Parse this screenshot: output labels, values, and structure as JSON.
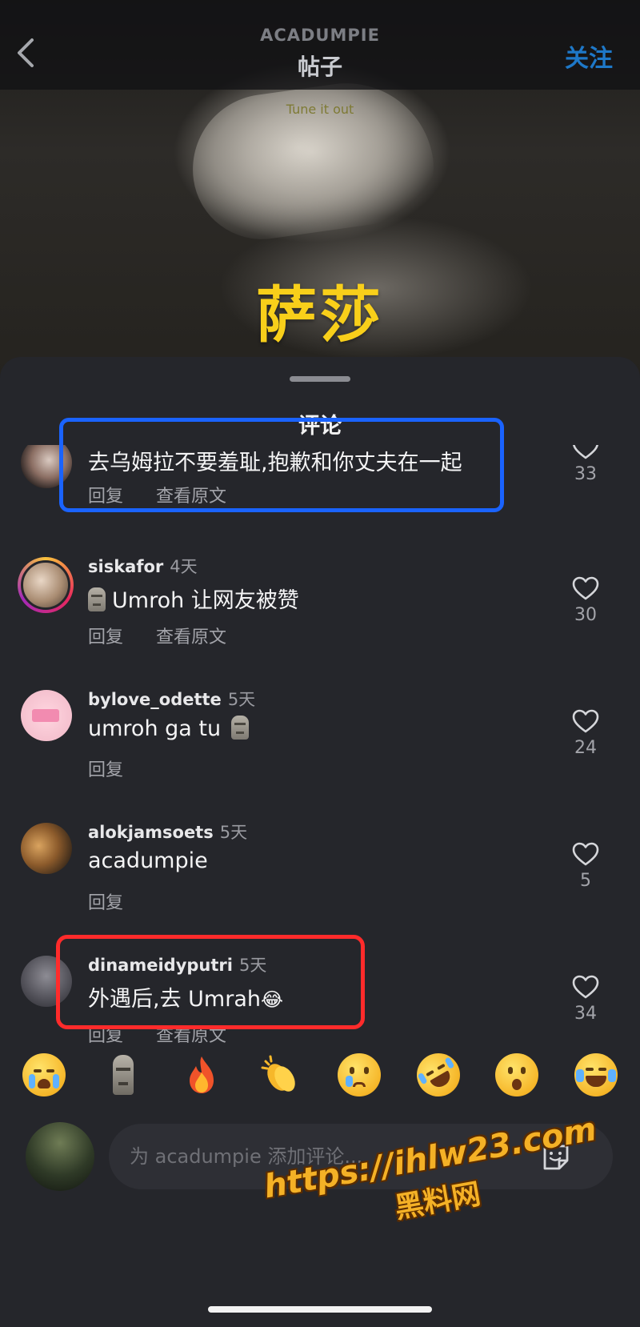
{
  "header": {
    "username": "ACADUMPIE",
    "title": "帖子",
    "follow_label": "关注"
  },
  "video": {
    "music_tag": "Tune it out",
    "caption": "萨莎"
  },
  "comments_sheet": {
    "title": "评论",
    "comments": [
      {
        "username": "",
        "time": "",
        "text": "去乌姆拉不要羞耻,抱歉和你丈夫在一起",
        "reply_label": "回复",
        "see_original_label": "查看原文",
        "likes": "33"
      },
      {
        "username": "siskafor",
        "time": "4天",
        "text": "Umroh 让网友被赞",
        "reply_label": "回复",
        "see_original_label": "查看原文",
        "likes": "30"
      },
      {
        "username": "bylove_odette",
        "time": "5天",
        "text": "umroh ga tu",
        "reply_label": "回复",
        "see_original_label": "",
        "likes": "24"
      },
      {
        "username": "alokjamsoets",
        "time": "5天",
        "text": "acadumpie",
        "reply_label": "回复",
        "see_original_label": "",
        "likes": "5"
      },
      {
        "username": "dinameidyputri",
        "time": "5天",
        "text": "外遇后,去 Umrah",
        "reply_label": "回复",
        "see_original_label": "查看原文",
        "likes": "34"
      }
    ]
  },
  "emoji_bar": [
    "loudly-crying-face",
    "moai",
    "fire",
    "clapping-hands",
    "crying-face",
    "rolling-on-floor-laughing",
    "surprised-face",
    "face-with-tears-of-joy"
  ],
  "comment_input": {
    "placeholder": "为 acadumpie 添加评论..."
  },
  "watermark": {
    "url": "https://ihlw23.com",
    "name": "黑料网"
  },
  "colors": {
    "accent_blue": "#1e78c8",
    "caption_yellow": "#f8cf1a",
    "highlight_blue": "#1a63ff",
    "highlight_red": "#ff2b2b",
    "sheet_bg": "#25262b"
  }
}
